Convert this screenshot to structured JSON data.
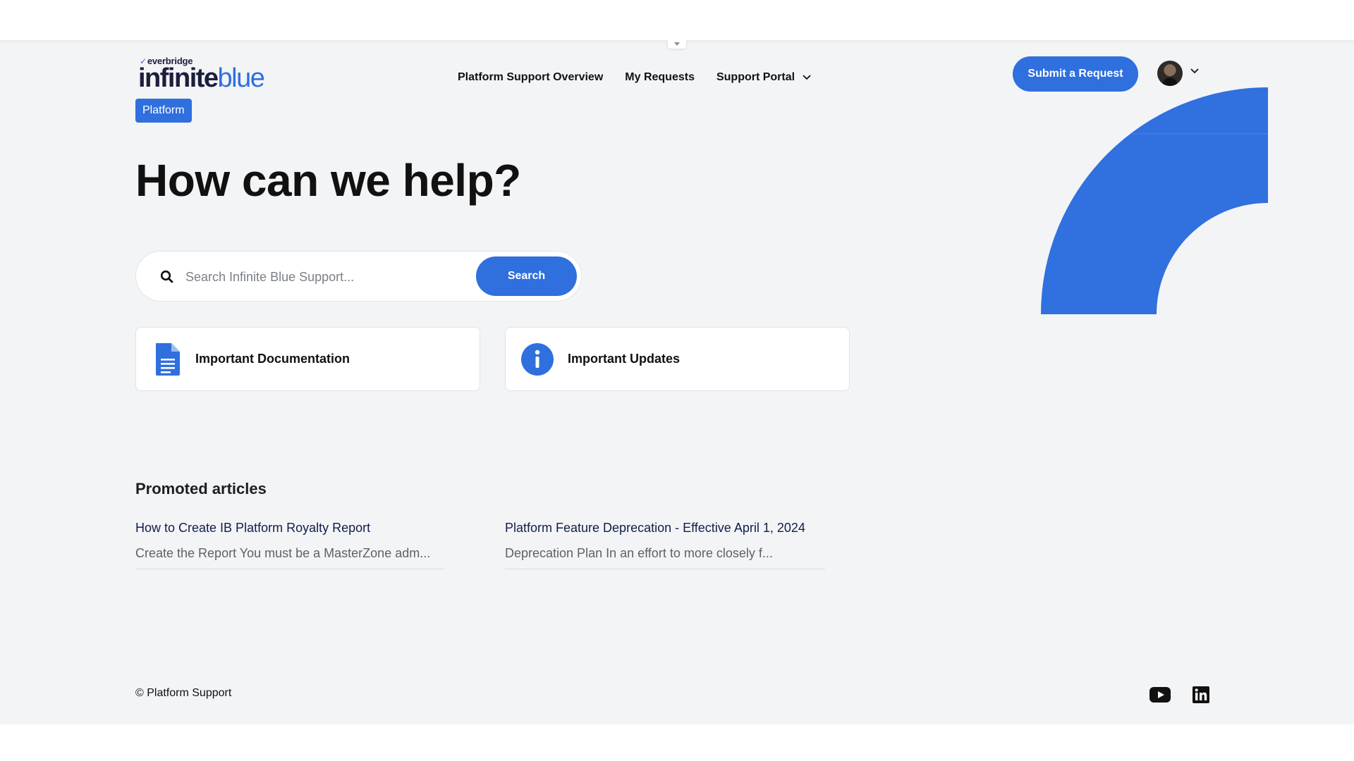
{
  "brand": {
    "parent_name": "everbridge",
    "name_part1": "infinite",
    "name_part2": "blue",
    "badge": "Platform",
    "accent_color": "#2f6fde"
  },
  "nav": {
    "items": [
      {
        "label": "Platform Support Overview"
      },
      {
        "label": "My Requests"
      },
      {
        "label": "Support Portal",
        "has_dropdown": true
      }
    ],
    "submit_label": "Submit a Request",
    "avatar_icon": "user-avatar"
  },
  "hero": {
    "title": "How can we help?"
  },
  "search": {
    "placeholder": "Search Infinite Blue Support...",
    "button_label": "Search",
    "icon": "search-icon"
  },
  "cards": [
    {
      "label": "Important Documentation",
      "icon": "document-icon"
    },
    {
      "label": "Important Updates",
      "icon": "info-icon"
    }
  ],
  "promoted": {
    "heading": "Promoted articles",
    "articles": [
      {
        "title": "How to Create IB Platform Royalty Report",
        "excerpt": "Create the Report You must be a MasterZone adm..."
      },
      {
        "title": "Platform Feature Deprecation - Effective April 1, 2024",
        "excerpt": "Deprecation Plan In an effort to more closely f..."
      }
    ]
  },
  "footer": {
    "copyright": "© Platform Support",
    "social": [
      "youtube-icon",
      "linkedin-icon"
    ]
  }
}
